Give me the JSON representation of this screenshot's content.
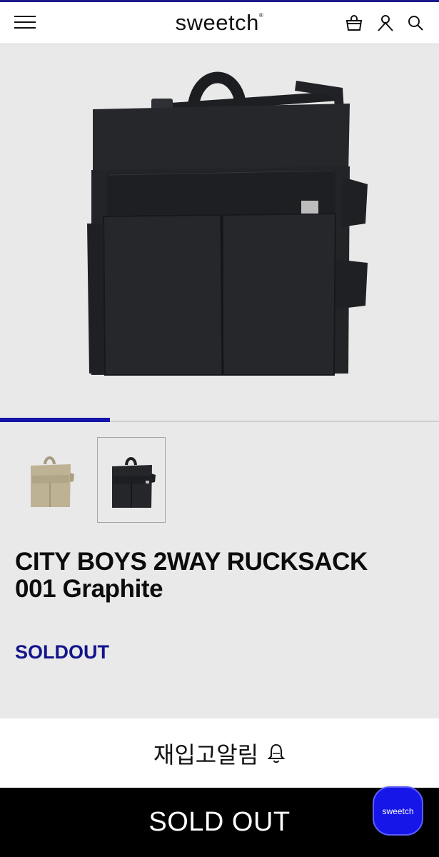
{
  "header": {
    "logo": "sweetch",
    "logo_mark": "®",
    "icons": [
      "menu-icon",
      "bag-icon",
      "user-icon",
      "search-icon"
    ]
  },
  "gallery": {
    "progress_fraction": 0.25,
    "progress_color": "#1414a8",
    "thumbnails": [
      {
        "color": "beige",
        "selected": false
      },
      {
        "color": "graphite",
        "selected": true
      }
    ]
  },
  "product": {
    "title_line1": "CITY BOYS 2WAY RUCKSACK",
    "title_line2": "001 Graphite",
    "status": "SOLDOUT",
    "status_color": "#14148c"
  },
  "restock": {
    "label": "재입고알림",
    "icon": "bell-icon"
  },
  "footer": {
    "sold_out_label": "SOLD OUT"
  },
  "chat": {
    "label": "sweetch",
    "color": "#1616e8"
  }
}
